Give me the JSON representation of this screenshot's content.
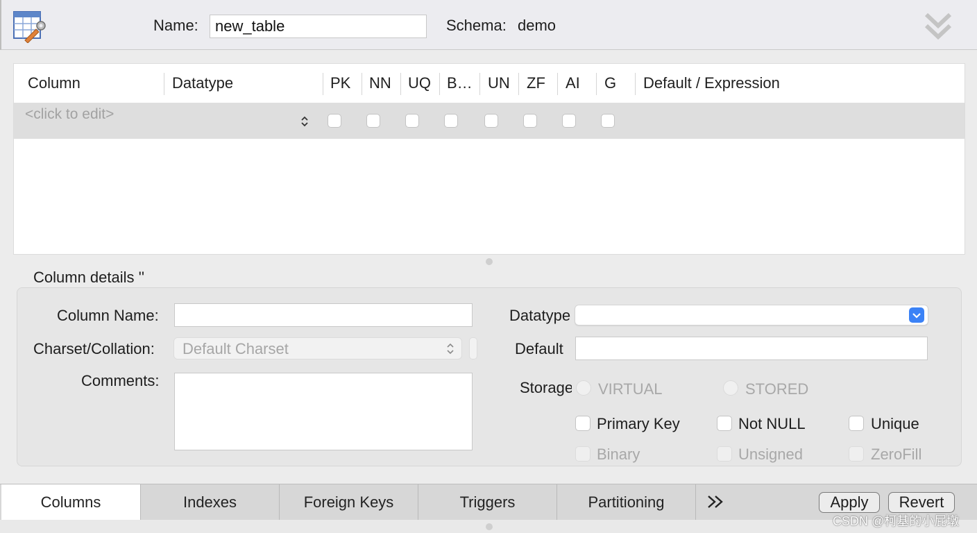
{
  "header": {
    "name_label": "Name:",
    "name_value": "new_table",
    "schema_label": "Schema:",
    "schema_value": "demo"
  },
  "grid": {
    "headers": [
      "Column",
      "Datatype",
      "PK",
      "NN",
      "UQ",
      "B…",
      "UN",
      "ZF",
      "AI",
      "G",
      "Default / Expression"
    ],
    "new_row_placeholder": "<click to edit>"
  },
  "details": {
    "title": "Column details ''",
    "column_name_label": "Column Name:",
    "charset_label": "Charset/Collation:",
    "charset_value": "Default Charset",
    "comments_label": "Comments:",
    "datatype_label": "Datatype",
    "default_label": "Default",
    "storage_label": "Storage",
    "storage_options": [
      "VIRTUAL",
      "STORED"
    ],
    "flags": {
      "primary_key": "Primary Key",
      "not_null": "Not NULL",
      "unique": "Unique",
      "binary": "Binary",
      "unsigned": "Unsigned",
      "zerofill": "ZeroFill"
    }
  },
  "tabs": [
    "Columns",
    "Indexes",
    "Foreign Keys",
    "Triggers",
    "Partitioning"
  ],
  "active_tab": "Columns",
  "buttons": {
    "apply": "Apply",
    "revert": "Revert"
  },
  "watermark": "CSDN @柯基的小屁墩",
  "colors": {
    "accent": "#3b82f6",
    "row_highlight": "#dedede",
    "tab_active": "#ffffff"
  }
}
